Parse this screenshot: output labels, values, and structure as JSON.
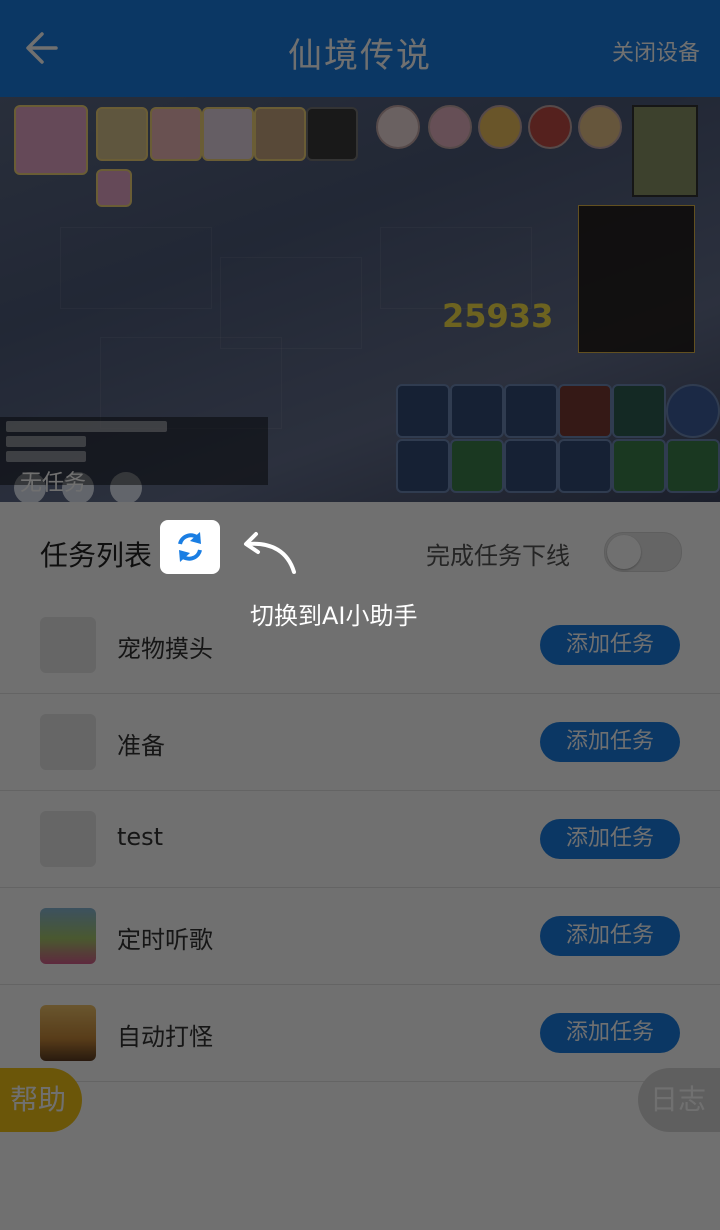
{
  "header": {
    "title": "仙境传说",
    "close_device": "关闭设备",
    "back_icon": "arrow-left-icon"
  },
  "game": {
    "no_task_label": "无任务",
    "damage_number": "25933"
  },
  "task_section": {
    "title": "任务列表",
    "switch_icon": "refresh-icon",
    "offline_label": "完成任务下线",
    "offline_enabled": false,
    "hint": "切换到AI小助手"
  },
  "tasks": [
    {
      "name": "宠物摸头",
      "icon": "gamepad-icon",
      "button": "添加任务"
    },
    {
      "name": "准备",
      "icon": "gamepad-icon",
      "button": "添加任务"
    },
    {
      "name": "test",
      "icon": "gamepad-icon",
      "button": "添加任务"
    },
    {
      "name": "定时听歌",
      "icon": "flower-thumbnail",
      "button": "添加任务"
    },
    {
      "name": "自动打怪",
      "icon": "house-thumbnail",
      "button": "添加任务"
    }
  ],
  "floating": {
    "help": "帮助",
    "log": "日志"
  },
  "colors": {
    "primary": "#1a7ee3",
    "help": "#f3c416",
    "overlay": "rgba(0,0,0,0.56)"
  }
}
